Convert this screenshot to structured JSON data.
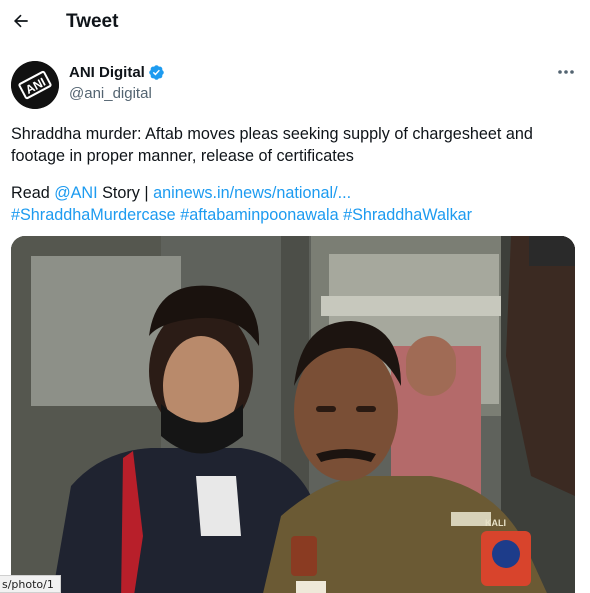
{
  "header": {
    "title": "Tweet"
  },
  "tweet": {
    "author_name": "ANI Digital",
    "author_handle": "@ani_digital",
    "avatar_text": "ANI",
    "text_line1": "Shraddha murder: Aftab moves pleas seeking supply of chargesheet and",
    "text_line2": "footage in proper manner, release of certificates",
    "read_prefix": "Read ",
    "mention": "@ANI",
    "story_label": " Story | ",
    "story_link": "aninews.in/news/national/...",
    "hashtags": [
      "#ShraddhaMurdercase",
      "#aftabaminpoonawala",
      "#ShraddhaWalkar"
    ],
    "photo_badge": "KALI"
  },
  "status_bar": {
    "url": "s/photo/1"
  },
  "colors": {
    "link": "#1d9bf0",
    "verified": "#1d9bf0",
    "text": "#0f1419",
    "secondary": "#536471"
  }
}
